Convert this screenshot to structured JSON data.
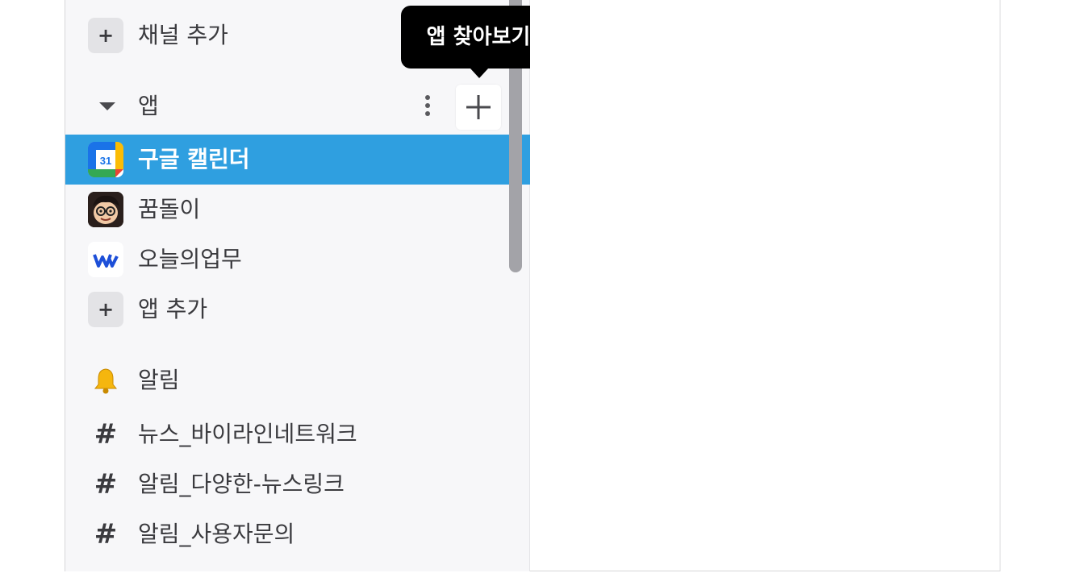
{
  "sidebar": {
    "add_channel_label": "채널 추가",
    "apps_section": {
      "title": "앱",
      "tooltip": "앱 찾아보기"
    },
    "apps": [
      {
        "label": "구글 캘린더",
        "icon": "google-calendar-icon",
        "icon_text": "31",
        "selected": true
      },
      {
        "label": "꿈돌이",
        "icon": "kkumdori-avatar-icon",
        "selected": false
      },
      {
        "label": "오늘의업무",
        "icon": "works-logo-icon",
        "selected": false
      }
    ],
    "add_app_label": "앱 추가",
    "channels": [
      {
        "label": "알림",
        "icon": "bell-icon"
      },
      {
        "label": "뉴스_바이라인네트워크",
        "icon": "hash-icon"
      },
      {
        "label": "알림_다양한-뉴스링크",
        "icon": "hash-icon"
      },
      {
        "label": "알림_사용자문의",
        "icon": "hash-icon"
      }
    ]
  },
  "colors": {
    "selected_bg": "#2f9fe0",
    "sidebar_bg": "#f7f7f9",
    "tooltip_bg": "#000000",
    "text": "#3a3a3e"
  }
}
